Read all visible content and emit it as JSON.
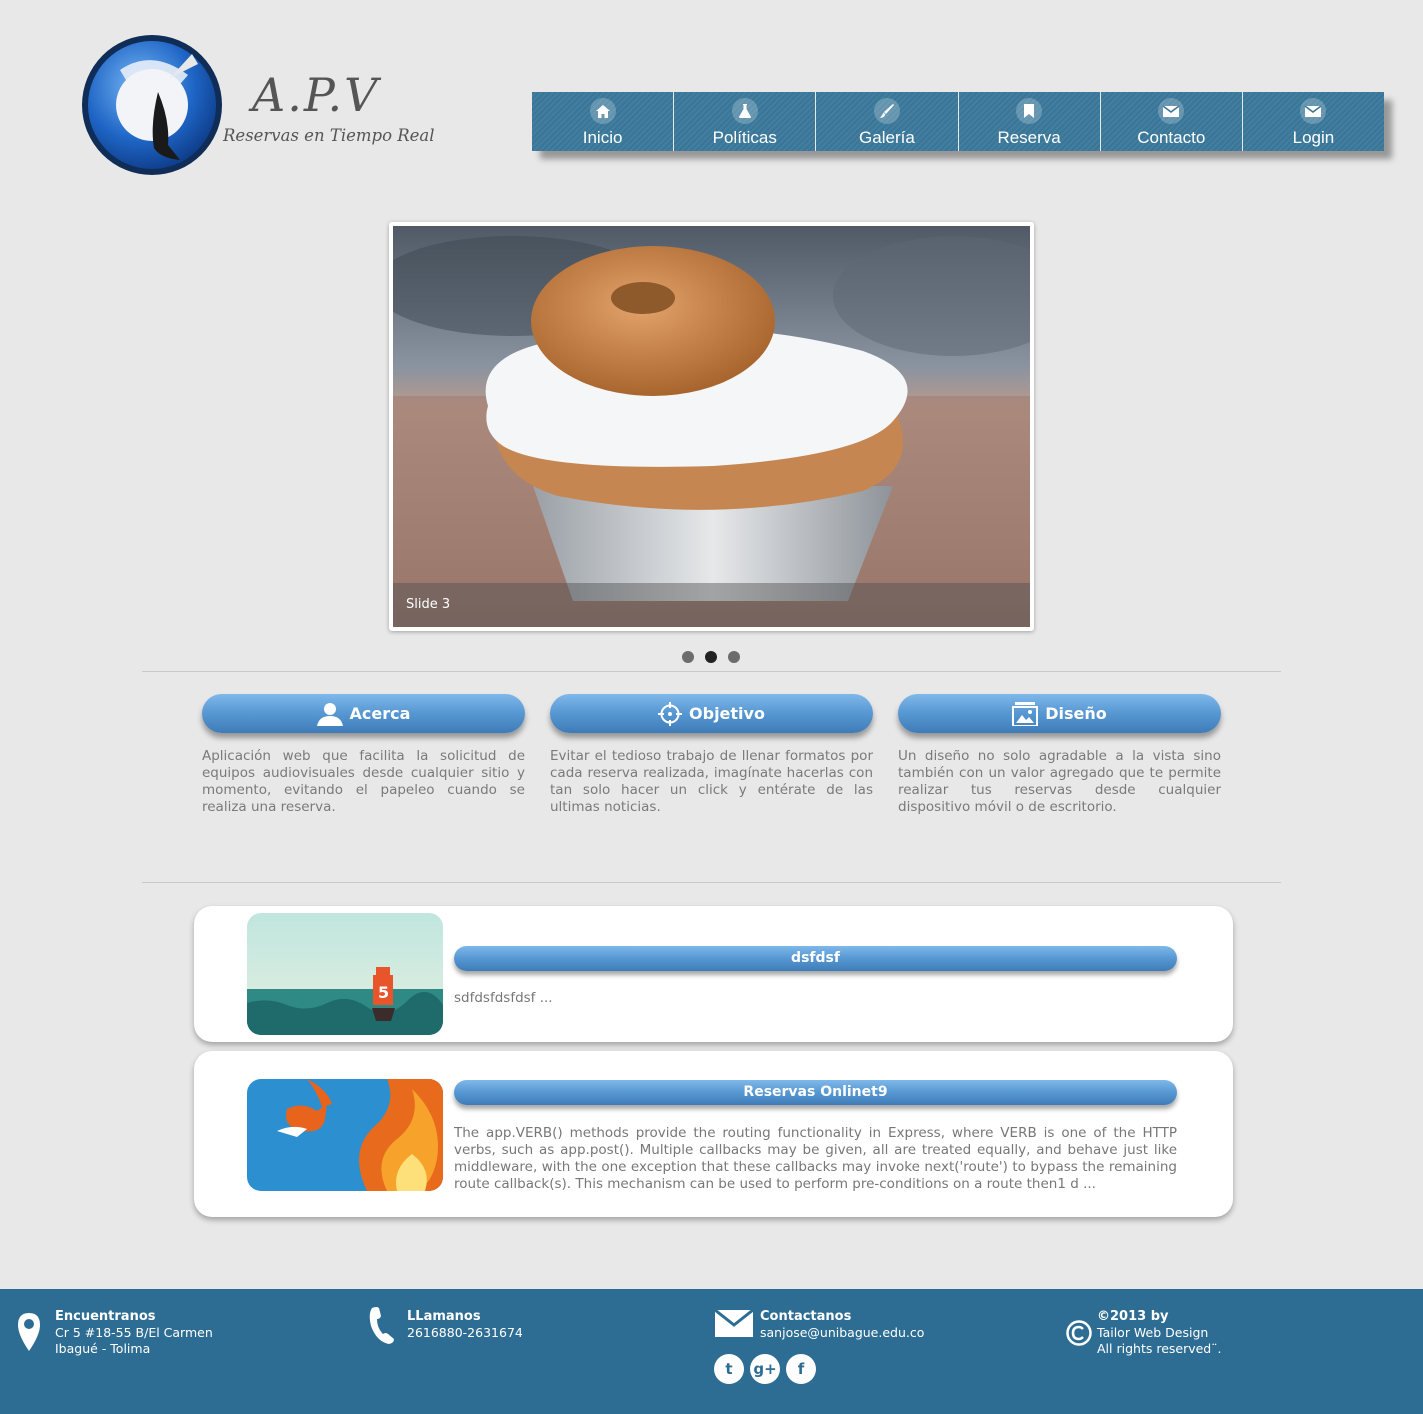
{
  "header": {
    "brand": "A.P.V",
    "tagline": "Reservas en Tiempo Real"
  },
  "nav": {
    "items": [
      {
        "label": "Inicio",
        "icon": "home-icon"
      },
      {
        "label": "Políticas",
        "icon": "flask-icon"
      },
      {
        "label": "Galería",
        "icon": "brush-icon"
      },
      {
        "label": "Reserva",
        "icon": "bookmark-icon"
      },
      {
        "label": "Contacto",
        "icon": "mail-icon"
      },
      {
        "label": "Login",
        "icon": "mail-icon"
      }
    ],
    "color": "#3a7597"
  },
  "slider": {
    "caption": "Slide 3",
    "active_index": 1,
    "count": 3
  },
  "features": [
    {
      "title": "Acerca",
      "icon": "user-icon",
      "text": "Aplicación web que facilita la solicitud de equipos audiovisuales desde cualquier sitio y momento, evitando el papeleo cuando se realiza una reserva."
    },
    {
      "title": "Objetivo",
      "icon": "crosshair-icon",
      "text": "Evitar el tedioso trabajo de llenar formatos por cada reserva realizada, imagínate hacerlas con tan solo hacer un click y entérate de las ultimas noticias."
    },
    {
      "title": "Diseño",
      "icon": "gallery-icon",
      "text": "Un diseño no solo agradable a la vista sino también con un valor agregado que te permite realizar tus reservas desde cualquier dispositivo móvil o de escritorio."
    }
  ],
  "news": [
    {
      "title": "dsfdsf",
      "body": "sdfdsfdsfdsf ...",
      "thumb": "html5-ship-image"
    },
    {
      "title": "Reservas Onlinet9",
      "body": "The app.VERB() methods provide the routing functionality in Express, where VERB is one of the HTTP verbs, such as app.post(). Multiple callbacks may be given, all are treated equally, and behave just like middleware, with the one exception that these callbacks may invoke next('route') to bypass the remaining route callback(s). This mechanism can be used to perform pre-conditions on a route then1 d ...",
      "thumb": "firefox-fox-image"
    }
  ],
  "footer": {
    "location": {
      "title": "Encuentranos",
      "line1": "Cr 5 #18-55 B/El Carmen",
      "line2": "Ibagué - Tolima"
    },
    "phone": {
      "title": "LLamanos",
      "line1": "2616880-2631674"
    },
    "contact": {
      "title": "Contactanos",
      "line1": "sanjose@unibague.edu.co"
    },
    "copyright": {
      "title": "©2013 by",
      "line1": "Tailor Web Design",
      "line2": "All rights reserved¨."
    },
    "social": [
      "t",
      "g+",
      "f"
    ],
    "color": "#2e6d93"
  }
}
